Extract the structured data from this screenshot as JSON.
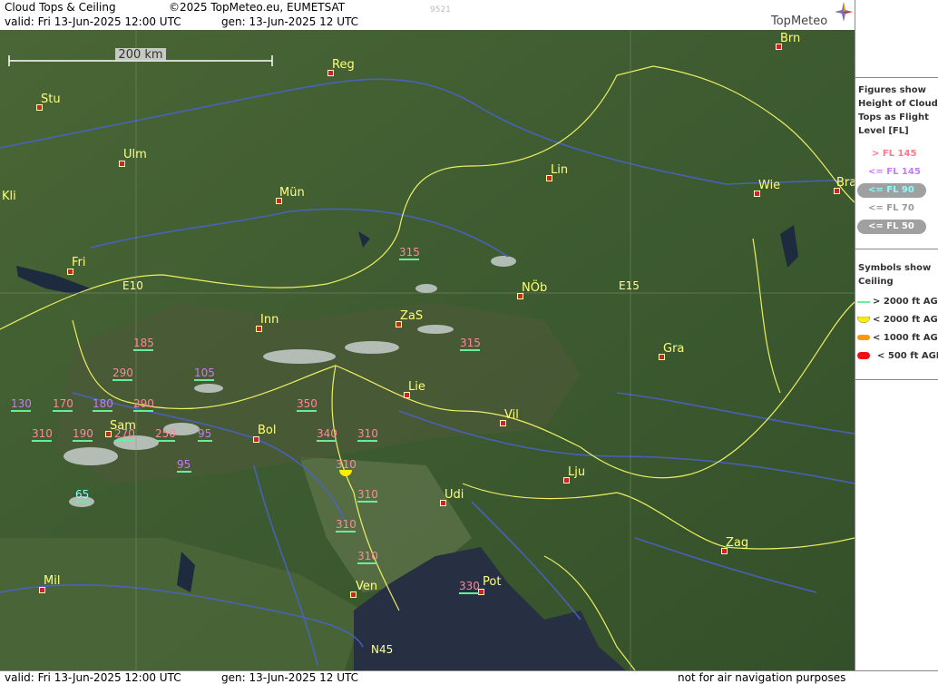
{
  "header": {
    "title": "Cloud Tops & Ceiling",
    "copyright": "©2025 TopMeteo.eu, EUMETSAT",
    "image_code": "9521",
    "valid": "valid:  Fri  13-Jun-2025  12:00 UTC",
    "gen": "gen: 13-Jun-2025 12 UTC",
    "logo": "TopMeteo"
  },
  "footer": {
    "valid": "valid:  Fri  13-Jun-2025  12:00 UTC",
    "gen": "gen: 13-Jun-2025 12 UTC",
    "disclaimer": "not for air navigation purposes"
  },
  "scale": {
    "label": "200 km"
  },
  "legend": {
    "tops_title_1": "Figures show",
    "tops_title_2": "Height of Cloud",
    "tops_title_3": "Tops as Flight",
    "tops_title_4": "Level  [FL]",
    "tops_items": [
      {
        "label": "> FL 145",
        "color": "#ff7788"
      },
      {
        "label": "<= FL 145",
        "color": "#cc77ff"
      },
      {
        "label": "<= FL 90",
        "color": "#88ffff"
      },
      {
        "label": "<= FL 70",
        "color": "#999999"
      },
      {
        "label": "<= FL 50",
        "color": "#ffffff"
      }
    ],
    "ceiling_title_1": "Symbols show",
    "ceiling_title_2": "Ceiling",
    "ceiling_items": [
      {
        "label": "> 2000 ft AGL",
        "color": "#66ee99"
      },
      {
        "label": "< 2000 ft AGL",
        "color": "#ffee00"
      },
      {
        "label": "< 1000 ft AGL",
        "color": "#ff9900"
      },
      {
        "label": "< 500 ft AGL",
        "color": "#ee1111"
      }
    ]
  },
  "cities": [
    {
      "name": "Brn"
    },
    {
      "name": "Reg"
    },
    {
      "name": "Stu"
    },
    {
      "name": "Ulm"
    },
    {
      "name": "Kli"
    },
    {
      "name": "Mün"
    },
    {
      "name": "Lin"
    },
    {
      "name": "Wie"
    },
    {
      "name": "Bra"
    },
    {
      "name": "Fri"
    },
    {
      "name": "Inn"
    },
    {
      "name": "ZaS"
    },
    {
      "name": "NÖb"
    },
    {
      "name": "Gra"
    },
    {
      "name": "Lie"
    },
    {
      "name": "Vil"
    },
    {
      "name": "Bol"
    },
    {
      "name": "Sam"
    },
    {
      "name": "Lju"
    },
    {
      "name": "Udi"
    },
    {
      "name": "Zag"
    },
    {
      "name": "Mil"
    },
    {
      "name": "Ven"
    },
    {
      "name": "Pot"
    }
  ],
  "grid_labels": [
    "E10",
    "E15",
    "N45"
  ],
  "cloud_tops": [
    {
      "value": "315",
      "color": "#ff8899"
    },
    {
      "value": "315",
      "color": "#ff8899"
    },
    {
      "value": "185",
      "color": "#ff8899"
    },
    {
      "value": "290",
      "color": "#ff8899"
    },
    {
      "value": "105",
      "color": "#cc77ff"
    },
    {
      "value": "130",
      "color": "#cc77ff"
    },
    {
      "value": "170",
      "color": "#ff8899"
    },
    {
      "value": "180",
      "color": "#cc77ff"
    },
    {
      "value": "290",
      "color": "#ff8899"
    },
    {
      "value": "350",
      "color": "#ff8899"
    },
    {
      "value": "310",
      "color": "#ff8899"
    },
    {
      "value": "190",
      "color": "#ff8899"
    },
    {
      "value": "270",
      "color": "#ff8899"
    },
    {
      "value": "250",
      "color": "#ff8899"
    },
    {
      "value": "95",
      "color": "#cc77ff"
    },
    {
      "value": "340",
      "color": "#ff8899"
    },
    {
      "value": "310",
      "color": "#ff8899"
    },
    {
      "value": "95",
      "color": "#cc77ff"
    },
    {
      "value": "310",
      "color": "#ff8899"
    },
    {
      "value": "65",
      "color": "#88ffff"
    },
    {
      "value": "310",
      "color": "#ff8899"
    },
    {
      "value": "310",
      "color": "#ff8899"
    },
    {
      "value": "310",
      "color": "#ff8899"
    },
    {
      "value": "330",
      "color": "#ff8899"
    }
  ]
}
